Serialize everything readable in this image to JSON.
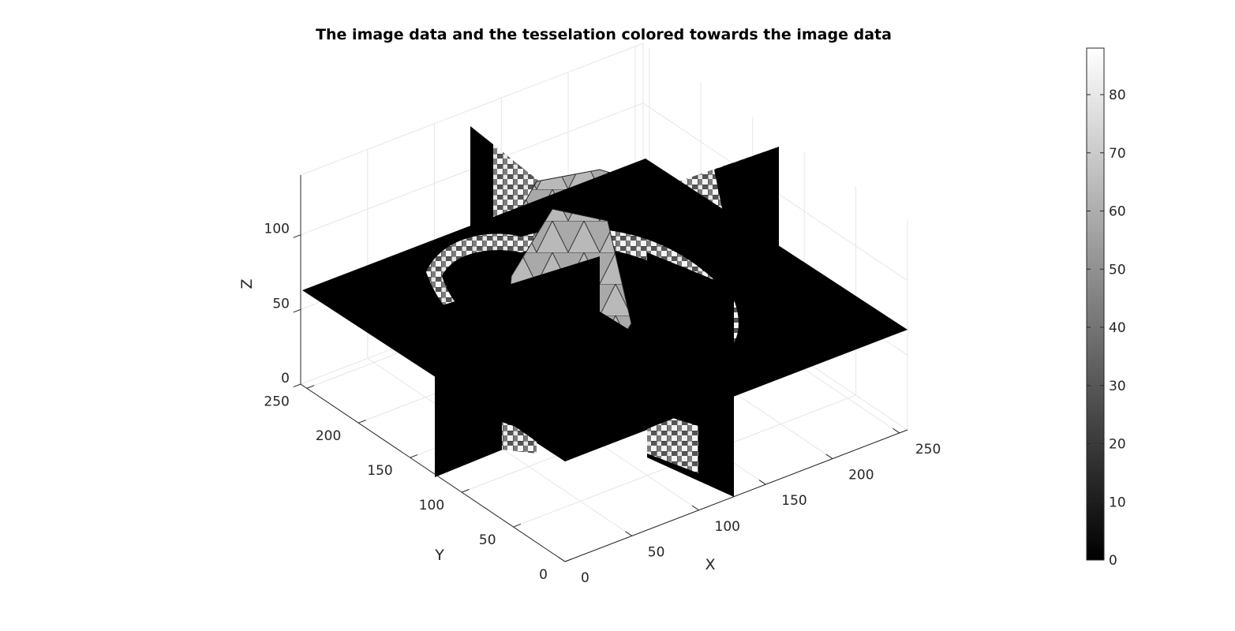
{
  "chart_data": {
    "type": "surface",
    "title": "The image data and the tesselation colored towards the image data",
    "xlabel": "X",
    "ylabel": "Y",
    "zlabel": "Z",
    "x_ticks": [
      "0",
      "50",
      "100",
      "150",
      "200",
      "250"
    ],
    "y_ticks": [
      "0",
      "50",
      "100",
      "150",
      "200",
      "250"
    ],
    "z_ticks": [
      "0",
      "50",
      "100"
    ],
    "xlim": [
      0,
      256
    ],
    "ylim": [
      0,
      256
    ],
    "zlim": [
      0,
      140
    ],
    "grid": true,
    "slices": {
      "x": 128,
      "y": 128,
      "z": 64
    },
    "colormap": "gray",
    "colorbar": {
      "position": "right",
      "range": [
        0,
        88
      ],
      "ticks": [
        "0",
        "10",
        "20",
        "30",
        "40",
        "50",
        "60",
        "70",
        "80"
      ]
    }
  }
}
